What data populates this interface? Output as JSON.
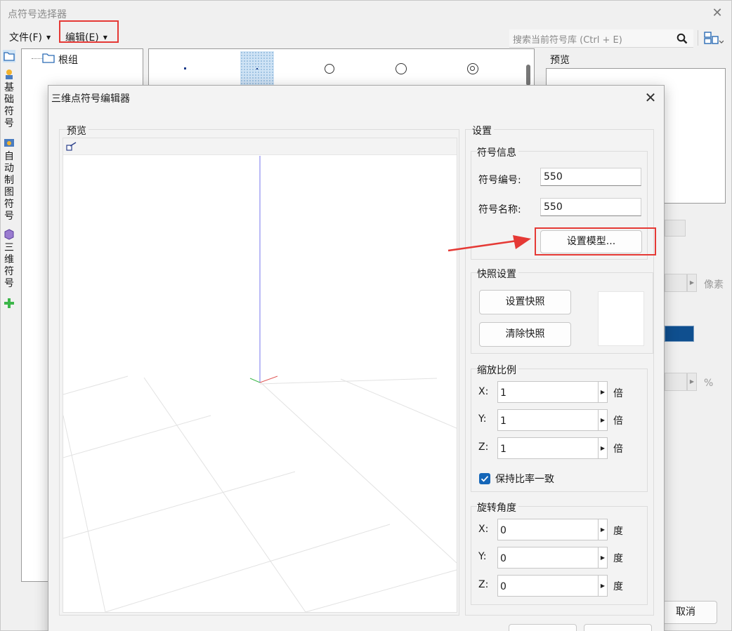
{
  "main_window": {
    "title": "点符号选择器",
    "menu": {
      "file_label": "文件(F)",
      "edit_label": "编辑(E)"
    },
    "search": {
      "placeholder": "搜索当前符号库 (Ctrl + E)"
    },
    "side_tabs": {
      "tab1": "基础符号",
      "tab2": "自动制图符号",
      "tab3": "三维符号"
    },
    "tree": {
      "root_label": "根组"
    },
    "preview_label": "预览",
    "size_unit": "像素",
    "percent_unit": "%",
    "cancel_label": "取消",
    "highlight_color": "#0f4f8f"
  },
  "editor_dialog": {
    "title": "三维点符号编辑器",
    "preview_group_label": "预览",
    "settings_group_label": "设置",
    "symbol_info": {
      "group_label": "符号信息",
      "id_label": "符号编号:",
      "id_value": "550",
      "name_label": "符号名称:",
      "name_value": "550",
      "set_model_label": "设置模型..."
    },
    "snapshot": {
      "group_label": "快照设置",
      "set_label": "设置快照",
      "clear_label": "清除快照"
    },
    "scale": {
      "group_label": "缩放比例",
      "x_label": "X:",
      "x_value": "1",
      "y_label": "Y:",
      "y_value": "1",
      "z_label": "Z:",
      "z_value": "1",
      "unit": "倍",
      "keep_ratio_label": "保持比率一致",
      "keep_ratio_checked": true
    },
    "rotation": {
      "group_label": "旋转角度",
      "x_label": "X:",
      "x_value": "0",
      "y_label": "Y:",
      "y_value": "0",
      "z_label": "Z:",
      "z_value": "0",
      "unit": "度"
    },
    "accent_color": "#1566b8"
  },
  "annotation": {
    "highlight_color": "#e53935"
  }
}
